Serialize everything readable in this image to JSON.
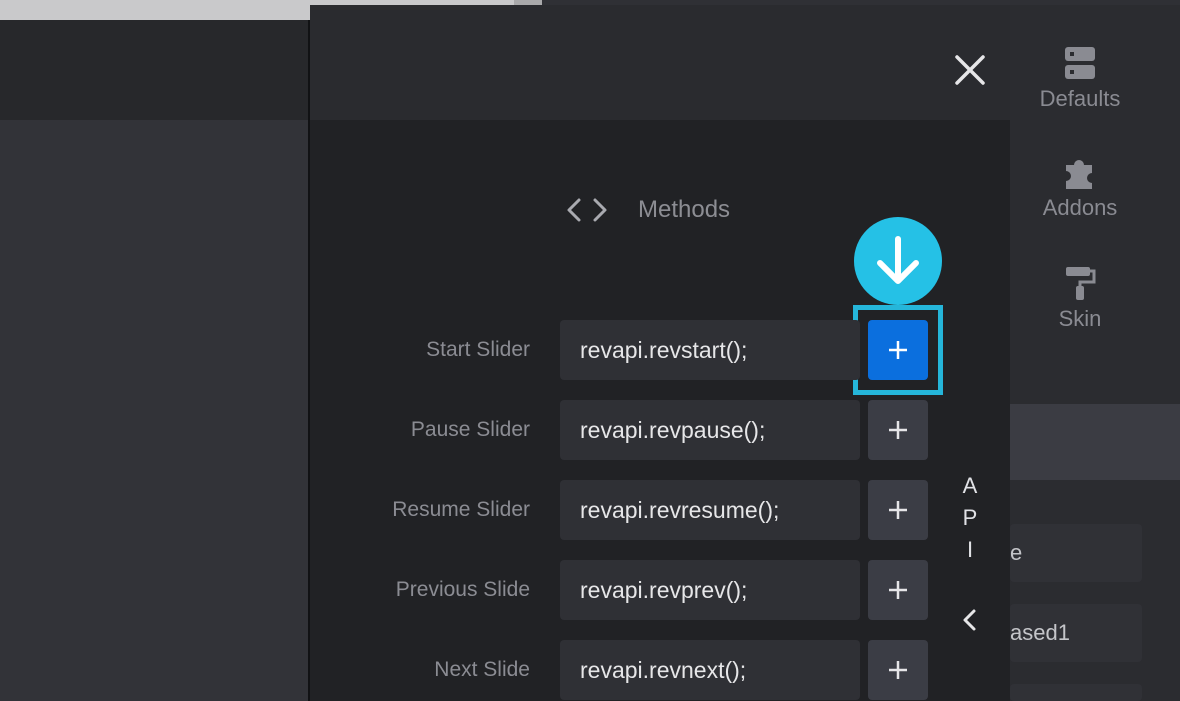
{
  "sidebar": {
    "items": [
      {
        "label": "Defaults",
        "icon": "server-icon"
      },
      {
        "label": "Addons",
        "icon": "puzzle-icon"
      },
      {
        "label": "Skin",
        "icon": "paint-roller-icon"
      }
    ]
  },
  "modal": {
    "title": "Methods",
    "title_icon": "code-icon",
    "close_icon": "close-icon",
    "rows": [
      {
        "label": "Start Slider",
        "code": "revapi.revstart();"
      },
      {
        "label": "Pause Slider",
        "code": "revapi.revpause();"
      },
      {
        "label": "Resume Slider",
        "code": "revapi.revresume();"
      },
      {
        "label": "Previous Slide",
        "code": "revapi.revprev();"
      },
      {
        "label": "Next Slide",
        "code": "revapi.revnext();"
      }
    ],
    "api_tab": [
      "A",
      "P",
      "I"
    ]
  },
  "right_fields": [
    "e",
    "ased1"
  ],
  "colors": {
    "accent": "#0b6fde",
    "highlight": "#25b6da",
    "badge": "#25c1e6",
    "modal_bg": "#212225"
  }
}
